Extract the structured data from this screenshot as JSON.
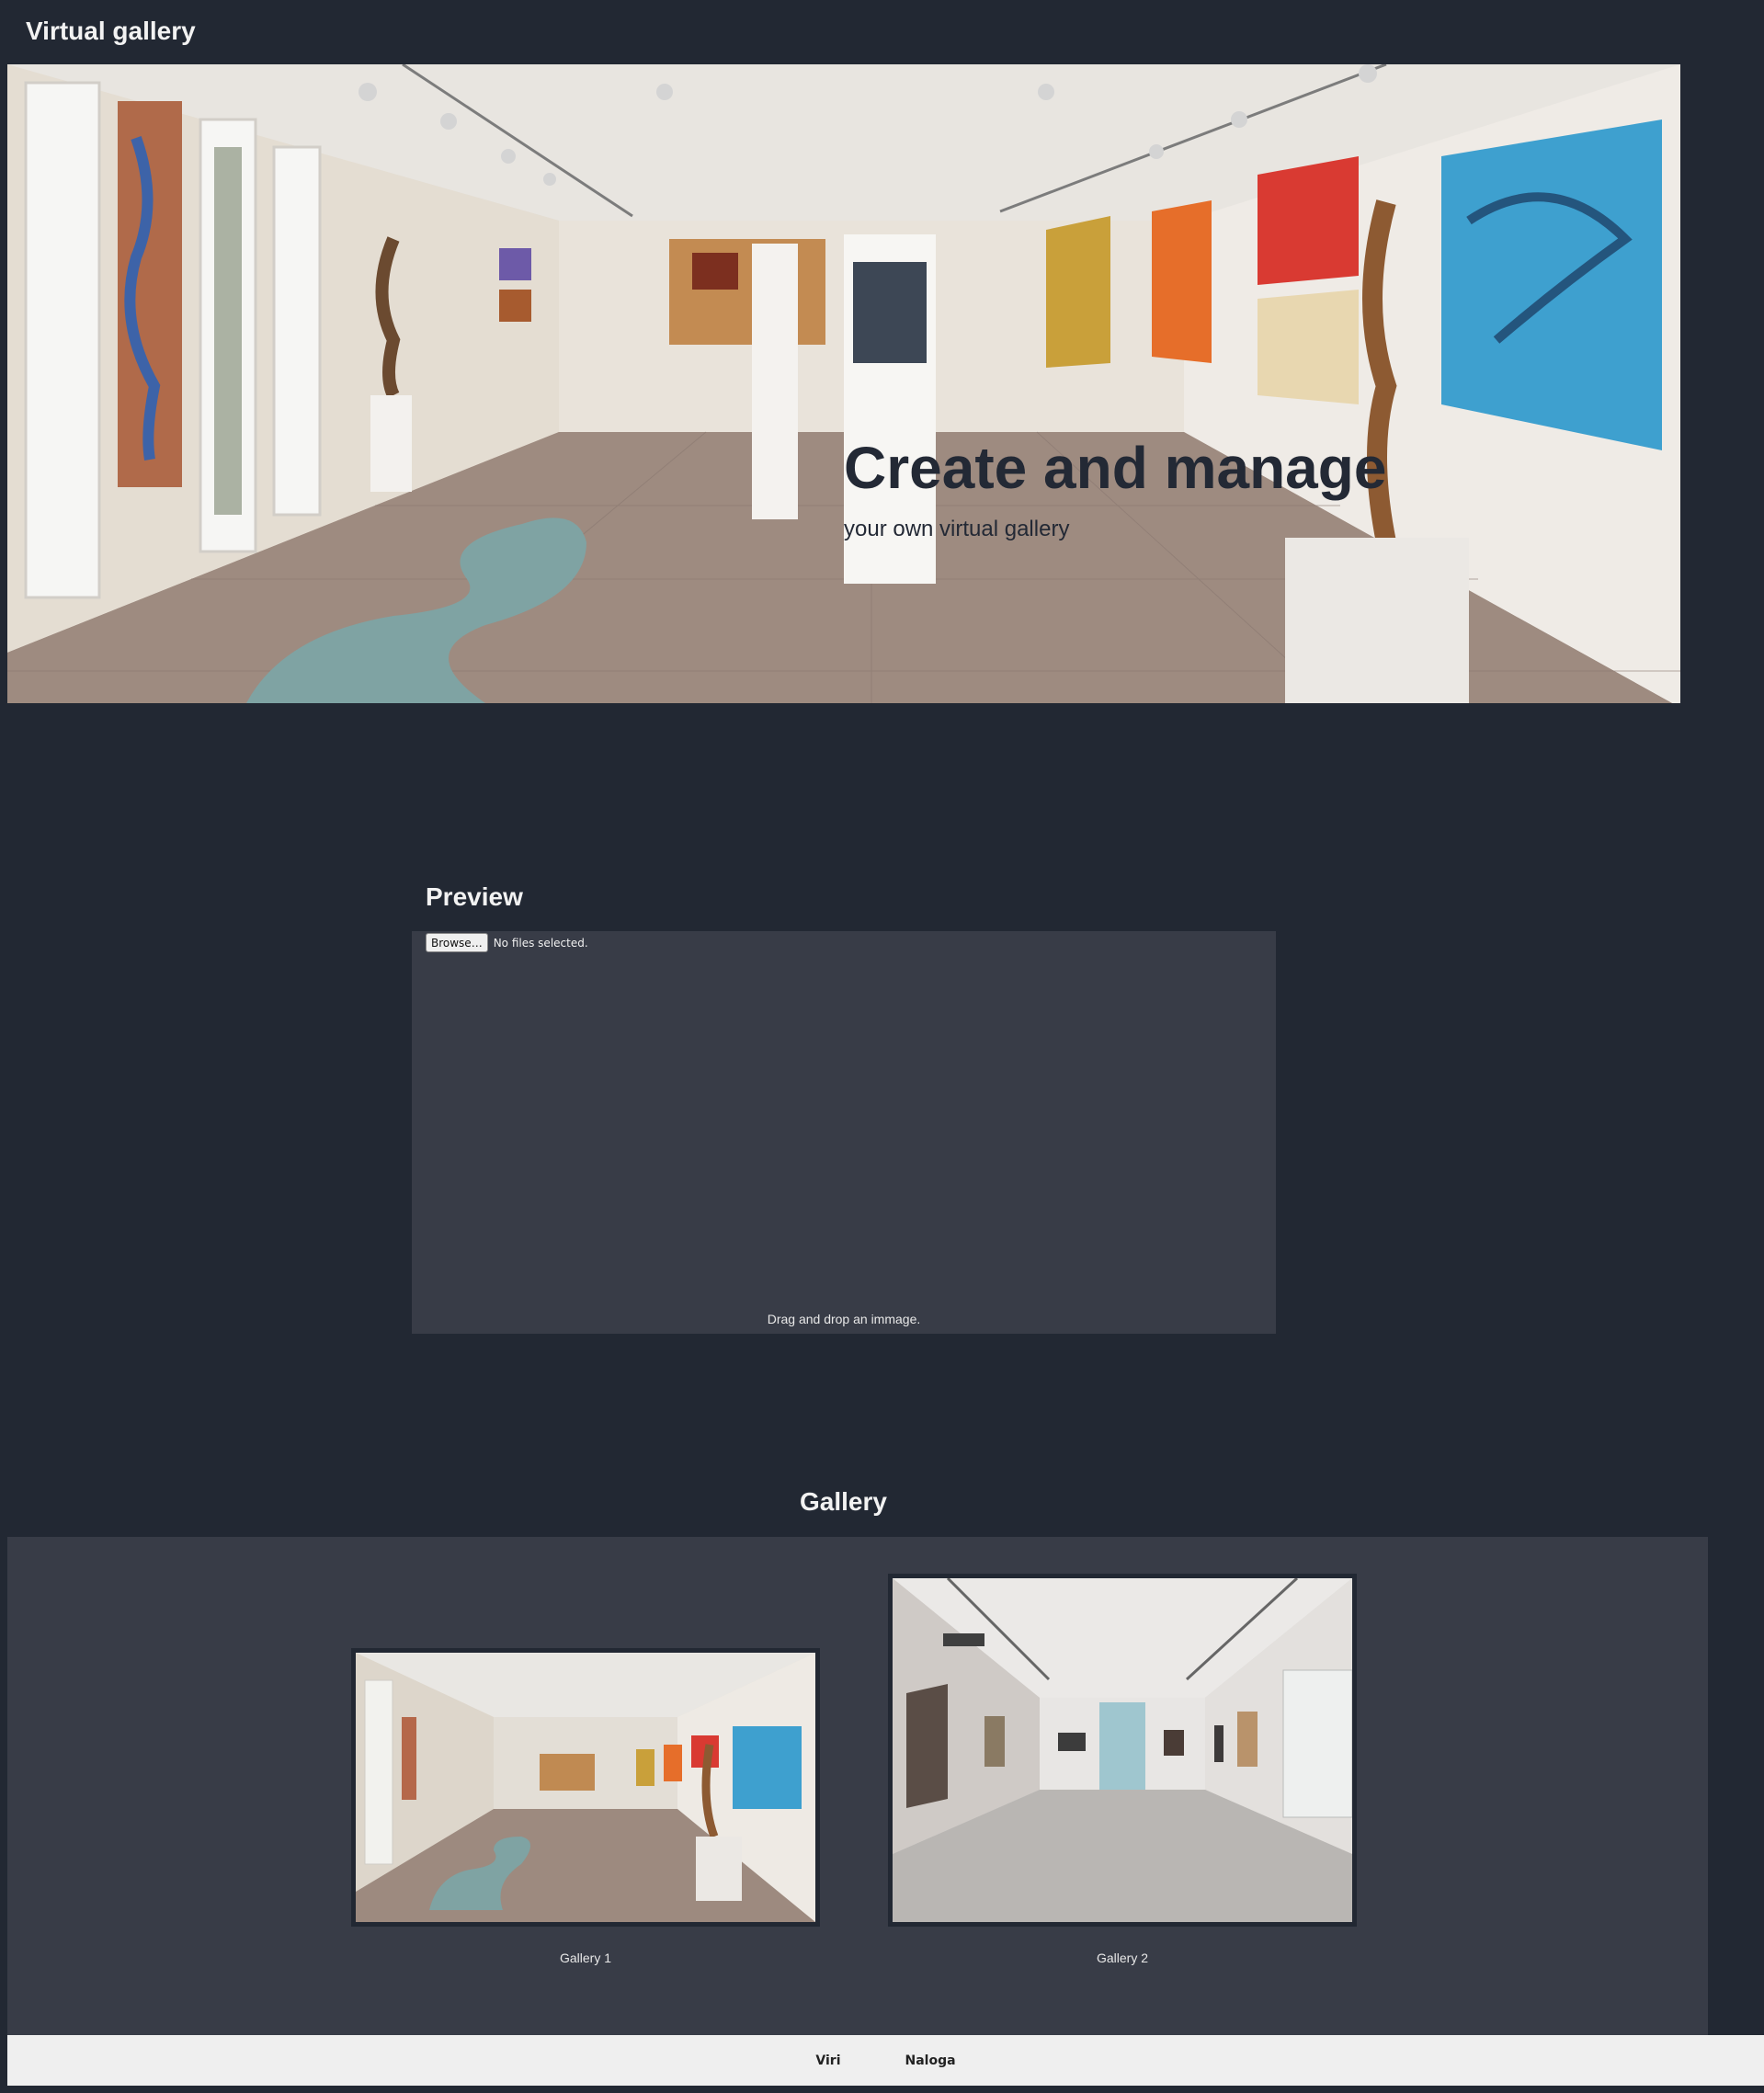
{
  "header": {
    "title": "Virtual gallery"
  },
  "hero": {
    "title": "Create and manage",
    "subtitle": "your own virtual gallery"
  },
  "preview": {
    "heading": "Preview",
    "browse_label": "Browse…",
    "file_status": "No files selected.",
    "drop_hint": "Drag and drop an immage."
  },
  "gallery": {
    "heading": "Gallery",
    "items": [
      {
        "label": "Gallery 1"
      },
      {
        "label": "Gallery 2"
      }
    ]
  },
  "footer": {
    "links": [
      {
        "label": "Viri"
      },
      {
        "label": "Naloga"
      }
    ]
  },
  "colors": {
    "background": "#222833",
    "panel": "#383c47",
    "footer": "#efefef",
    "hero_text": "#232935"
  }
}
